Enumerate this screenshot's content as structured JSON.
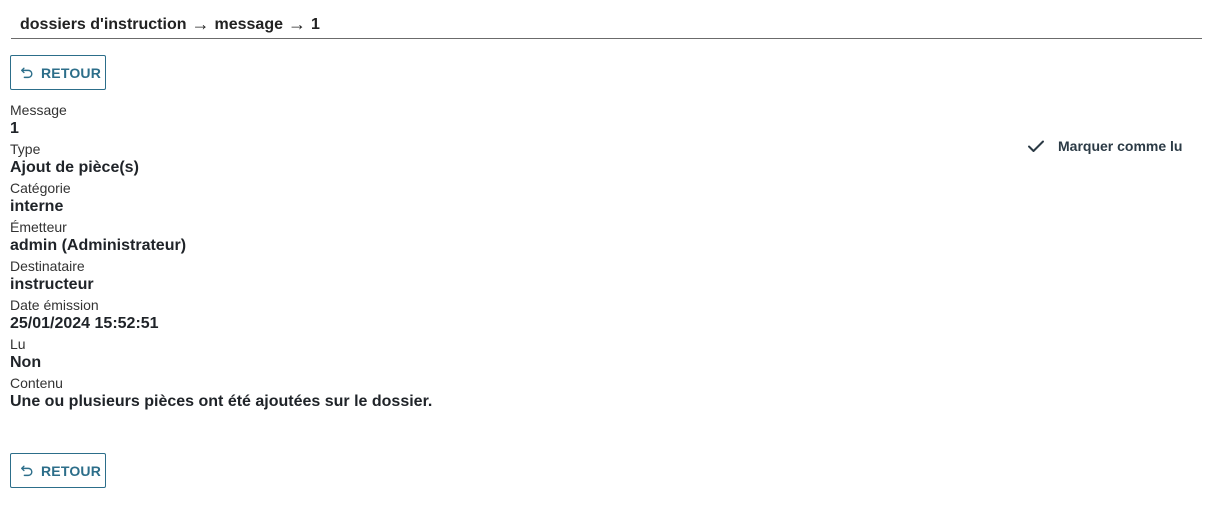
{
  "breadcrumb": {
    "items": [
      "dossiers d'instruction",
      "message",
      "1"
    ]
  },
  "buttons": {
    "back_label": "RETOUR",
    "mark_read_label": "Marquer comme lu"
  },
  "fields": [
    {
      "label": "Message",
      "value": "1"
    },
    {
      "label": "Type",
      "value": "Ajout de pièce(s)"
    },
    {
      "label": "Catégorie",
      "value": "interne"
    },
    {
      "label": "Émetteur",
      "value": "admin (Administrateur)"
    },
    {
      "label": "Destinataire",
      "value": "instructeur"
    },
    {
      "label": "Date émission",
      "value": "25/01/2024 15:52:51"
    },
    {
      "label": "Lu",
      "value": "Non"
    },
    {
      "label": "Contenu",
      "value": "Une ou plusieurs pièces ont été ajoutées sur le dossier."
    }
  ],
  "colors": {
    "accent": "#2c6e8a",
    "text": "#1f2328"
  },
  "icons": {
    "back": "undo-arrow-icon",
    "breadcrumb_separator": "arrow-right-icon",
    "mark_read": "check-icon"
  }
}
